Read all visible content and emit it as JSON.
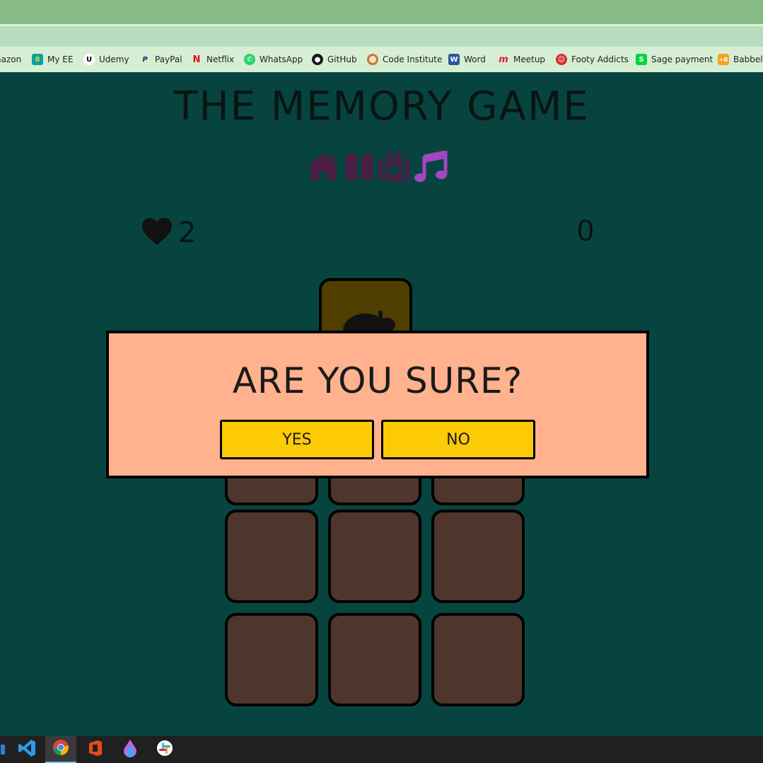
{
  "browser": {
    "bookmarks": [
      {
        "label": "nazon",
        "icon": "amazon-icon",
        "color": "#ff9900"
      },
      {
        "label": "My EE",
        "icon": "ee-icon",
        "color": "#ffd200"
      },
      {
        "label": "Udemy",
        "icon": "udemy-icon",
        "color": "#ffffff"
      },
      {
        "label": "PayPal",
        "icon": "paypal-icon",
        "color": "#003087"
      },
      {
        "label": "Netflix",
        "icon": "netflix-icon",
        "color": "#e50914"
      },
      {
        "label": "WhatsApp",
        "icon": "whatsapp-icon",
        "color": "#25d366"
      },
      {
        "label": "GitHub",
        "icon": "github-icon",
        "color": "#181717"
      },
      {
        "label": "Code Institute",
        "icon": "code-institute-icon",
        "color": "#e5692f"
      },
      {
        "label": "Word",
        "icon": "word-icon",
        "color": "#2b579a"
      },
      {
        "label": "Meetup",
        "icon": "meetup-icon",
        "color": "#e51937"
      },
      {
        "label": "Footy Addicts",
        "icon": "footy-addicts-icon",
        "color": "#d32f2f"
      },
      {
        "label": "Sage payment",
        "icon": "sage-icon",
        "color": "#00d639"
      },
      {
        "label": "Babbel",
        "icon": "babbel-icon",
        "color": "#f7a21b"
      }
    ]
  },
  "game": {
    "title": "THE MEMORY GAME",
    "controls": [
      {
        "name": "home-icon",
        "color": "#4a1d45"
      },
      {
        "name": "pause-icon",
        "color": "#4a1d45"
      },
      {
        "name": "first-aid-icon",
        "color": "#4a1d45"
      },
      {
        "name": "music-icon",
        "color": "#a445c4"
      }
    ],
    "lives": "2",
    "score": "0"
  },
  "modal": {
    "title": "ARE YOU SURE?",
    "yes_label": "YES",
    "no_label": "NO"
  },
  "colors": {
    "background": "#07443f",
    "card_back": "#4e362c",
    "modal_background": "#ffb28d",
    "button": "#fccb05"
  },
  "taskbar": {
    "apps": [
      "vscode-icon",
      "chrome-icon",
      "office-icon",
      "drop-icon",
      "slack-icon"
    ]
  }
}
